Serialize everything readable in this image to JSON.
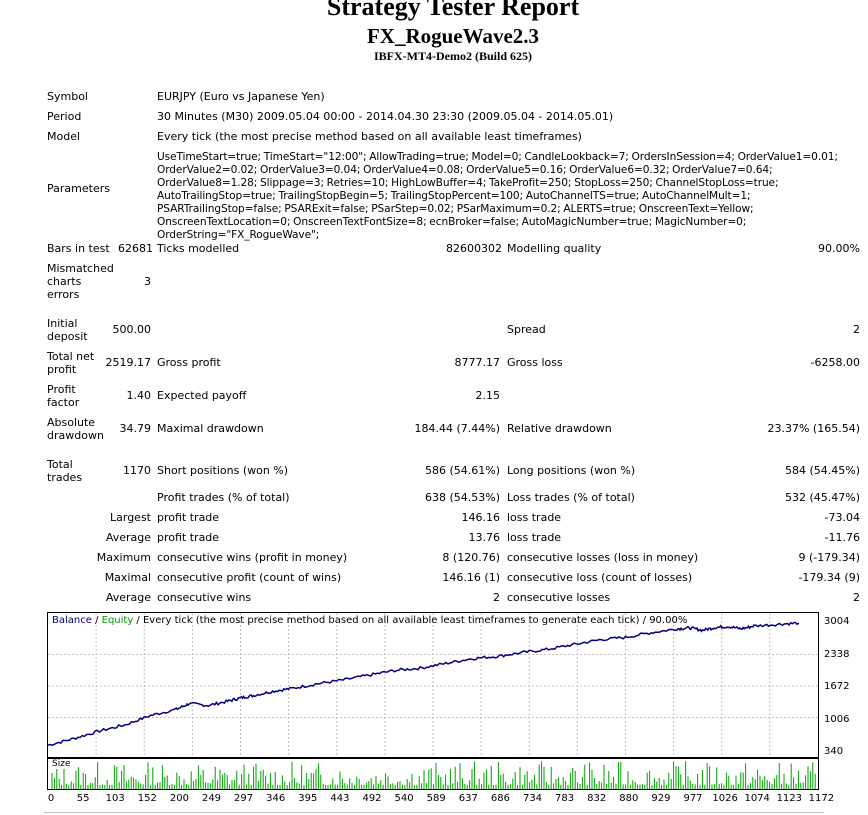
{
  "header": {
    "title": "Strategy Tester Report",
    "ea_name": "FX_RogueWave2.3",
    "server": "IBFX-MT4-Demo2 (Build 625)"
  },
  "info": {
    "symbol_label": "Symbol",
    "symbol_value": "EURJPY (Euro vs Japanese Yen)",
    "period_label": "Period",
    "period_value": "30 Minutes (M30) 2009.05.04 00:00 - 2014.04.30 23:30 (2009.05.04 - 2014.05.01)",
    "model_label": "Model",
    "model_value": "Every tick (the most precise method based on all available least timeframes)",
    "parameters_label": "Parameters",
    "parameters_value": "UseTimeStart=true; TimeStart=\"12:00\"; AllowTrading=true; Model=0; CandleLookback=7; OrdersInSession=4; OrderValue1=0.01; OrderValue2=0.02; OrderValue3=0.04; OrderValue4=0.08; OrderValue5=0.16; OrderValue6=0.32; OrderValue7=0.64; OrderValue8=1.28; Slippage=3; Retries=10; HighLowBuffer=4; TakeProfit=250; StopLoss=250; ChannelStopLoss=true; AutoTrailingStop=true; TrailingStopBegin=5; TrailingStopPercent=100; AutoChannelTS=true; AutoChannelMult=1; PSARTrailingStop=false; PSARExit=false; PSarStep=0.02; PSarMaximum=0.2; ALERTS=true; OnscreenText=Yellow; OnscreenTextLocation=0; OnscreenTextFontSize=8; ecnBroker=false; AutoMagicNumber=true; MagicNumber=0; OrderString=\"FX_RogueWave\";"
  },
  "stats": {
    "bars_label": "Bars in test",
    "bars_value": "62681",
    "ticks_label": "Ticks modelled",
    "ticks_value": "82600302",
    "quality_label": "Modelling quality",
    "quality_value": "90.00%",
    "mismatch_label_1": "Mismatched",
    "mismatch_label_2": "charts",
    "mismatch_label_3": "errors",
    "mismatch_value": "3",
    "deposit_label_1": "Initial",
    "deposit_label_2": "deposit",
    "deposit_value": "500.00",
    "spread_label": "Spread",
    "spread_value": "2",
    "netprofit_label_1": "Total net",
    "netprofit_label_2": "profit",
    "netprofit_value": "2519.17",
    "grossprofit_label": "Gross profit",
    "grossprofit_value": "8777.17",
    "grossloss_label": "Gross loss",
    "grossloss_value": "-6258.00",
    "pf_label_1": "Profit",
    "pf_label_2": "factor",
    "pf_value": "1.40",
    "expected_label": "Expected payoff",
    "expected_value": "2.15",
    "absdd_label_1": "Absolute",
    "absdd_label_2": "drawdown",
    "absdd_value": "34.79",
    "maxdd_label": "Maximal drawdown",
    "maxdd_value": "184.44 (7.44%)",
    "reldd_label": "Relative drawdown",
    "reldd_value": "23.37% (165.54)",
    "trades_label_1": "Total",
    "trades_label_2": "trades",
    "trades_value": "1170",
    "short_label": "Short positions (won %)",
    "short_value": "586 (54.61%)",
    "long_label": "Long positions (won %)",
    "long_value": "584 (54.45%)",
    "profit_trades_label": "Profit trades (% of total)",
    "profit_trades_value": "638 (54.53%)",
    "loss_trades_label": "Loss trades (% of total)",
    "loss_trades_value": "532 (45.47%)",
    "largest_label": "Largest",
    "largest_profit_label": "profit trade",
    "largest_profit_value": "146.16",
    "largest_loss_label": "loss trade",
    "largest_loss_value": "-73.04",
    "average_label": "Average",
    "average_profit_label": "profit trade",
    "average_profit_value": "13.76",
    "average_loss_label": "loss trade",
    "average_loss_value": "-11.76",
    "maximum_label": "Maximum",
    "max_wins_label": "consecutive wins (profit in money)",
    "max_wins_value": "8 (120.76)",
    "max_losses_label": "consecutive losses (loss in money)",
    "max_losses_value": "9 (-179.34)",
    "maximal_label": "Maximal",
    "maximal_profit_label": "consecutive profit (count of wins)",
    "maximal_profit_value": "146.16 (1)",
    "maximal_loss_label": "consecutive loss (count of losses)",
    "maximal_loss_value": "-179.34 (9)",
    "avg_label": "Average",
    "avg_wins_label": "consecutive wins",
    "avg_wins_value": "2",
    "avg_losses_label": "consecutive losses",
    "avg_losses_value": "2"
  },
  "chart_legend": {
    "balance": "Balance",
    "sep": " / ",
    "equity": "Equity",
    "rest": " / Every tick (the most precise method based on all available least timeframes to generate each tick) / 90.00%",
    "size_label": "Size"
  },
  "chart_data": {
    "type": "line",
    "xlabel": "",
    "ylabel": "",
    "y_ticks": [
      "3004",
      "2338",
      "1672",
      "1006",
      "340"
    ],
    "x_ticks": [
      "0",
      "55",
      "103",
      "152",
      "200",
      "249",
      "297",
      "346",
      "395",
      "443",
      "492",
      "540",
      "589",
      "637",
      "686",
      "734",
      "783",
      "832",
      "880",
      "929",
      "977",
      "1026",
      "1074",
      "1123",
      "1172"
    ],
    "xlim": [
      0,
      1200
    ],
    "ylim": [
      340,
      3004
    ],
    "grid": true,
    "colors": {
      "balance": "#000080",
      "equity": "#00a000",
      "size": "#00a000"
    },
    "series": [
      {
        "name": "Balance",
        "x": [
          0,
          40,
          80,
          120,
          160,
          200,
          220,
          250,
          280,
          300,
          320,
          350,
          380,
          420,
          460,
          500,
          540,
          580,
          620,
          660,
          700,
          740,
          780,
          820,
          860,
          900,
          940,
          980,
          1000,
          1020,
          1040,
          1060,
          1080,
          1100,
          1140,
          1170
        ],
        "values": [
          420,
          560,
          720,
          850,
          1050,
          1180,
          1300,
          1260,
          1350,
          1420,
          1470,
          1560,
          1620,
          1720,
          1800,
          1900,
          2000,
          2050,
          2150,
          2250,
          2300,
          2380,
          2450,
          2550,
          2650,
          2700,
          2800,
          2880,
          2900,
          2850,
          2910,
          2930,
          2880,
          2940,
          2980,
          3004
        ]
      }
    ]
  }
}
